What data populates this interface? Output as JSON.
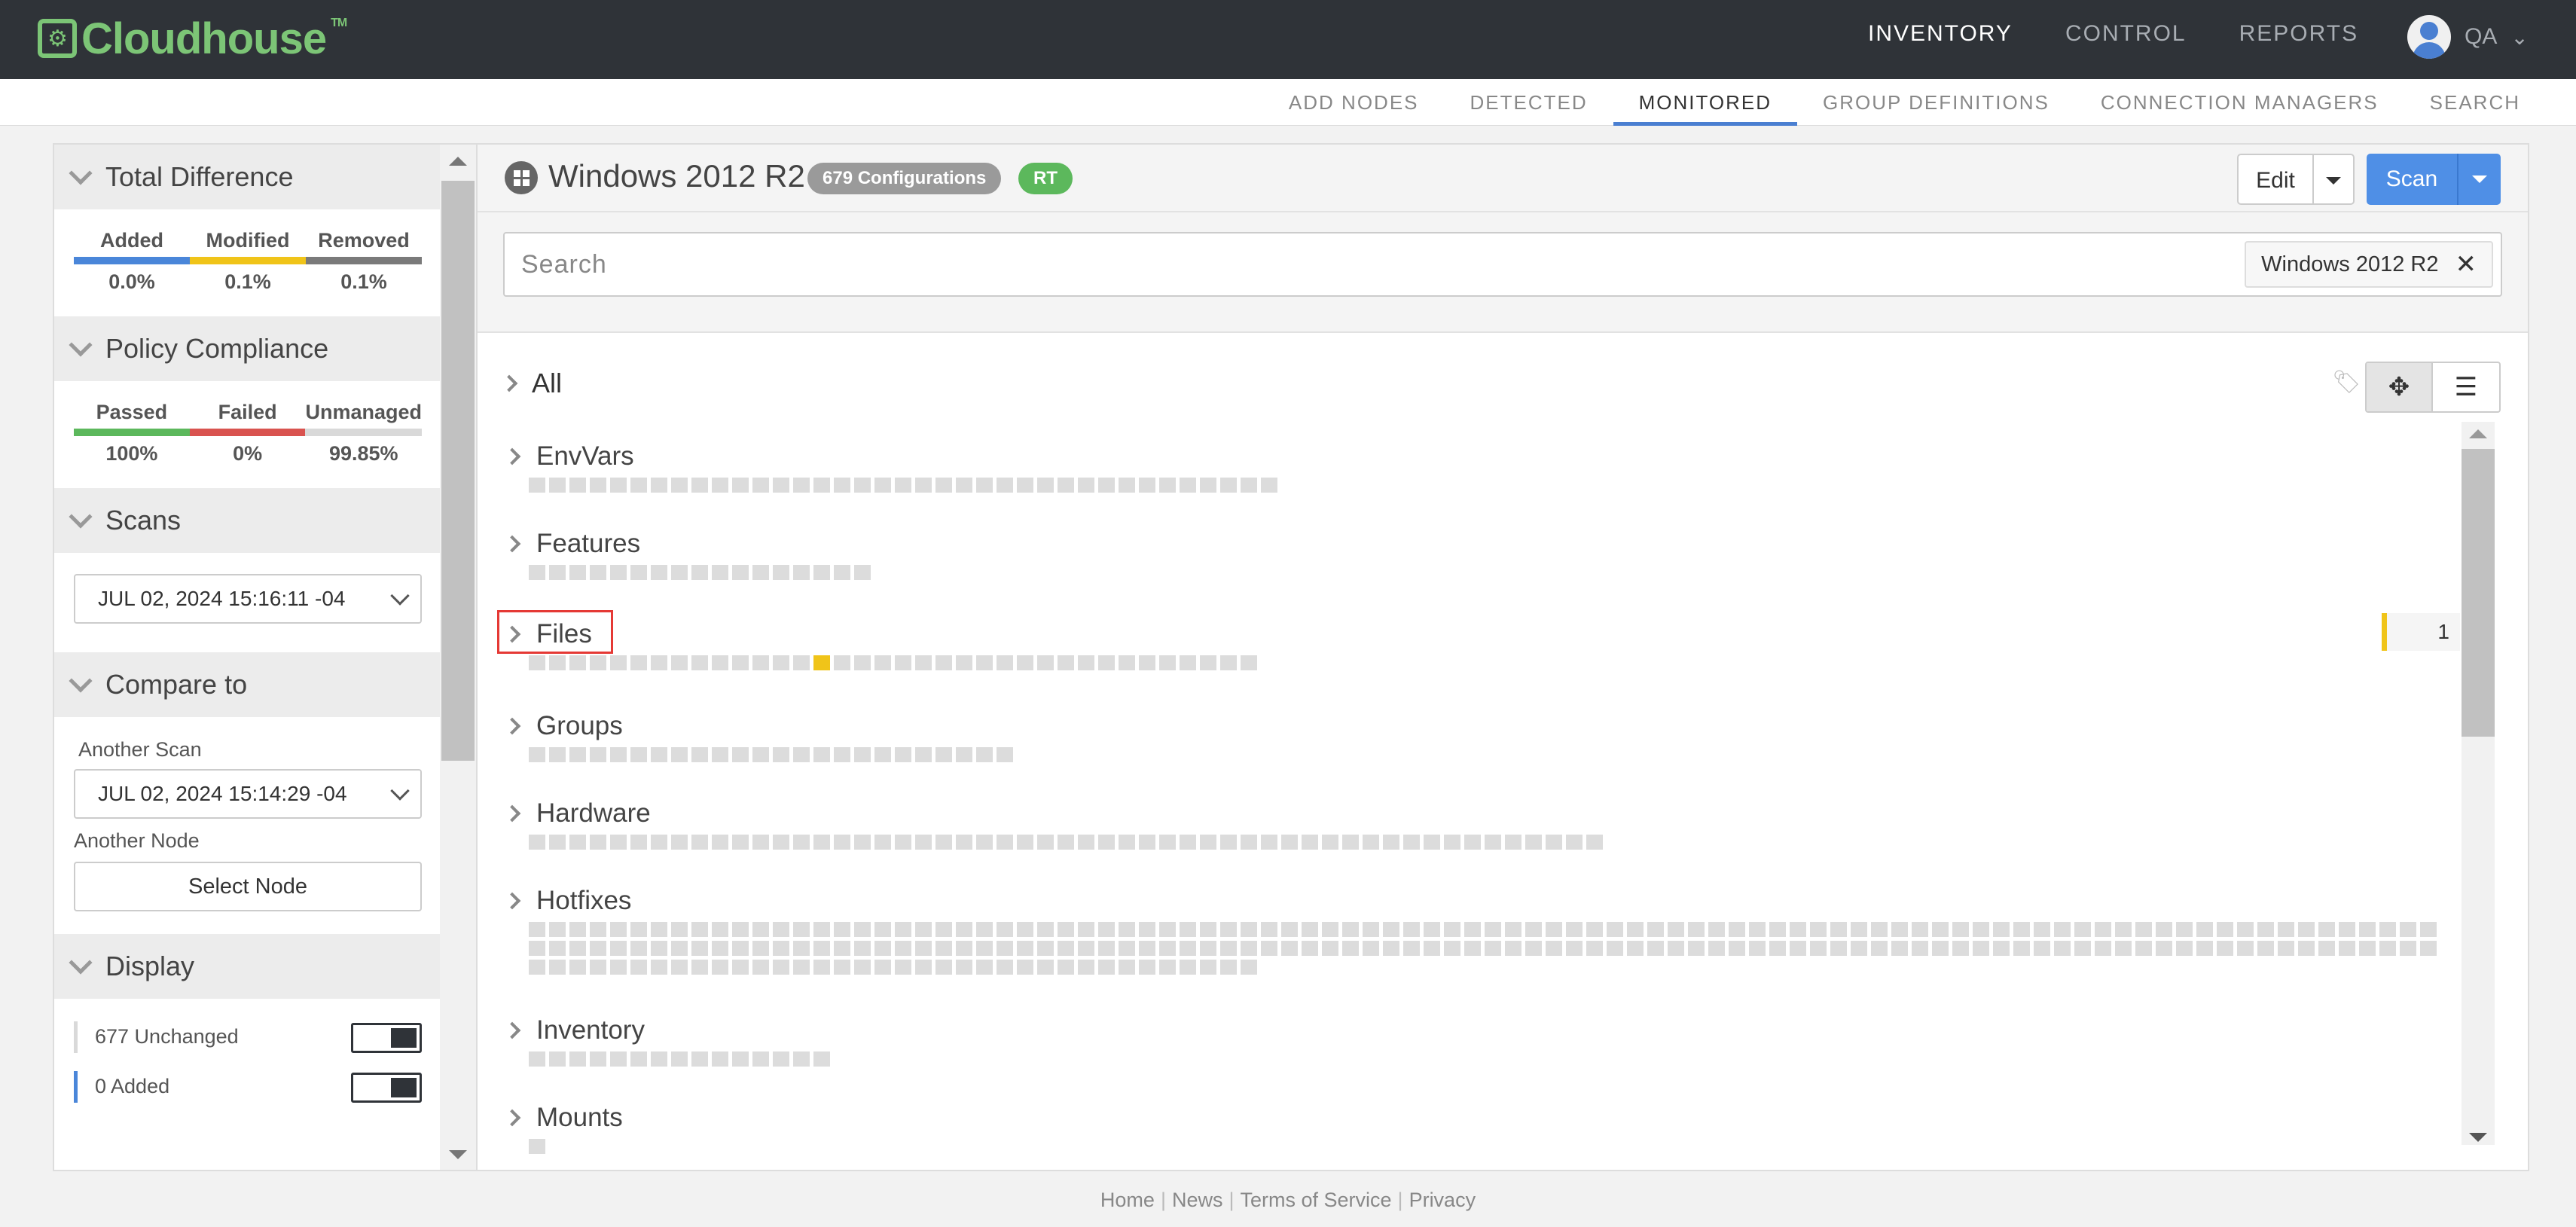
{
  "brand": {
    "name": "Cloudhouse",
    "tm": "TM"
  },
  "topnav": {
    "items": [
      "INVENTORY",
      "CONTROL",
      "REPORTS"
    ],
    "active": 0
  },
  "user": {
    "name": "QA"
  },
  "subnav": {
    "items": [
      "ADD NODES",
      "DETECTED",
      "MONITORED",
      "GROUP DEFINITIONS",
      "CONNECTION MANAGERS",
      "SEARCH"
    ],
    "active": 2
  },
  "sidebar": {
    "total_difference": {
      "title": "Total Difference",
      "cols": [
        {
          "label": "Added",
          "value": "0.0%",
          "color": "#4a86d9"
        },
        {
          "label": "Modified",
          "value": "0.1%",
          "color": "#f0c419"
        },
        {
          "label": "Removed",
          "value": "0.1%",
          "color": "#7a7a7a"
        }
      ]
    },
    "policy": {
      "title": "Policy Compliance",
      "cols": [
        {
          "label": "Passed",
          "value": "100%",
          "color": "#5cb85c"
        },
        {
          "label": "Failed",
          "value": "0%",
          "color": "#d9534f"
        },
        {
          "label": "Unmanaged",
          "value": "99.85%",
          "color": "#d9d9d9"
        }
      ]
    },
    "scans": {
      "title": "Scans",
      "selected": "JUL 02, 2024 15:16:11 -04"
    },
    "compare": {
      "title": "Compare to",
      "another_scan_label": "Another Scan",
      "another_scan_value": "JUL 02, 2024 15:14:29 -04",
      "another_node_label": "Another Node",
      "select_node_label": "Select Node"
    },
    "display": {
      "title": "Display",
      "rows": [
        {
          "label": "677 Unchanged",
          "color": "#d9d9d9"
        },
        {
          "label": "0 Added",
          "color": "#4a86d9"
        }
      ]
    }
  },
  "main": {
    "node_title": "Windows 2012 R2",
    "badge_configs": "679 Configurations",
    "badge_rt": "RT",
    "edit_label": "Edit",
    "scan_label": "Scan",
    "search_placeholder": "Search",
    "filter_chip": "Windows 2012 R2",
    "all_label": "All",
    "categories": [
      {
        "name": "EnvVars",
        "count": 37,
        "modified": []
      },
      {
        "name": "Features",
        "count": 17,
        "modified": []
      },
      {
        "name": "Files",
        "count": 36,
        "modified": [
          14
        ],
        "change_count": "1"
      },
      {
        "name": "Groups",
        "count": 24,
        "modified": []
      },
      {
        "name": "Hardware",
        "count": 53,
        "modified": []
      },
      {
        "name": "Hotfixes",
        "count": 224,
        "modified": []
      },
      {
        "name": "Inventory",
        "count": 15,
        "modified": []
      },
      {
        "name": "Mounts",
        "count": 1,
        "modified": []
      }
    ]
  },
  "footer": {
    "links": [
      "Home",
      "News",
      "Terms of Service",
      "Privacy"
    ]
  }
}
